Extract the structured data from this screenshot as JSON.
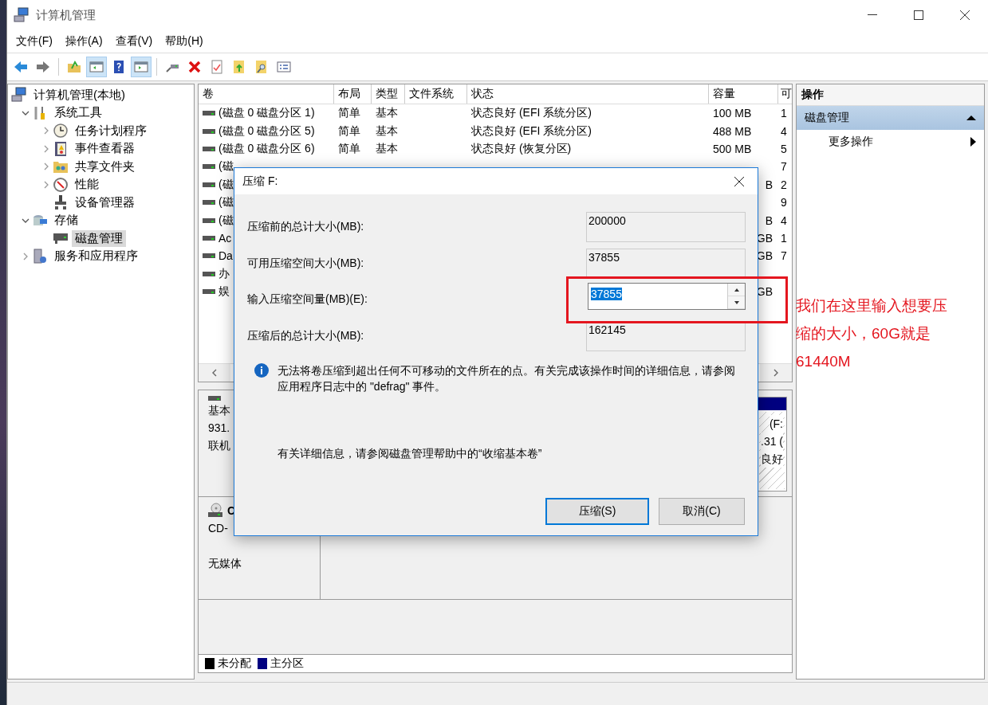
{
  "window": {
    "title": "计算机管理"
  },
  "menu": [
    "文件(F)",
    "操作(A)",
    "查看(V)",
    "帮助(H)"
  ],
  "toolbar": [
    {
      "pressed": false
    },
    {
      "pressed": false
    },
    {
      "pressed": false
    },
    {
      "pressed": true
    },
    {
      "pressed": false
    },
    {
      "pressed": true
    },
    {
      "pressed": false
    },
    {
      "pressed": false
    },
    {
      "pressed": false
    },
    {
      "pressed": false
    },
    {
      "pressed": false
    },
    {
      "pressed": false
    }
  ],
  "tree": [
    {
      "label": "计算机管理(本地)",
      "selected": false,
      "children": [
        {
          "label": "系统工具",
          "selected": false,
          "expanded": true,
          "children": [
            {
              "label": "任务计划程序",
              "selected": false,
              "expanded": false
            },
            {
              "label": "事件查看器",
              "selected": false,
              "expanded": false
            },
            {
              "label": "共享文件夹",
              "selected": false,
              "expanded": false
            },
            {
              "label": "性能",
              "selected": false,
              "expanded": false
            },
            {
              "label": "设备管理器",
              "selected": false
            }
          ]
        },
        {
          "label": "存储",
          "selected": false,
          "expanded": true,
          "children": [
            {
              "label": "磁盘管理",
              "selected": true
            }
          ]
        },
        {
          "label": "服务和应用程序",
          "selected": false,
          "expanded": false
        }
      ]
    }
  ],
  "table": {
    "columns": [
      "卷",
      "布局",
      "类型",
      "文件系统",
      "状态",
      "容量",
      "可"
    ],
    "rows": [
      {
        "kind": "full",
        "volume": "(磁盘 0 磁盘分区 1)",
        "layout": "简单",
        "type": "基本",
        "status": "状态良好 (EFI 系统分区)",
        "capacity": "100 MB",
        "column_7": "1"
      },
      {
        "kind": "full",
        "volume": "(磁盘 0 磁盘分区 5)",
        "layout": "简单",
        "type": "基本",
        "status": "状态良好 (EFI 系统分区)",
        "capacity": "488 MB",
        "column_7": "4"
      },
      {
        "kind": "full",
        "volume": "(磁盘 0 磁盘分区 6)",
        "layout": "简单",
        "type": "基本",
        "status": "状态良好 (恢复分区)",
        "capacity": "500 MB",
        "column_7": "5"
      },
      {
        "kind": "covered",
        "volume": "(磁",
        "column_7": "7"
      },
      {
        "kind": "covered",
        "volume": "(磁",
        "capacity": "B",
        "column_7": "2"
      },
      {
        "kind": "covered",
        "volume": "(磁",
        "column_7": "9"
      },
      {
        "kind": "covered",
        "volume": "(磁",
        "capacity": "B",
        "column_7": "4"
      },
      {
        "kind": "covered",
        "volume": "Ac",
        "capacity": "GB",
        "column_7": "1"
      },
      {
        "kind": "covered",
        "volume": "Da",
        "capacity": "GB",
        "column_7": "7"
      },
      {
        "kind": "covered",
        "volume": "办"
      },
      {
        "kind": "covered",
        "volume": "娱",
        "capacity": "GB"
      }
    ]
  },
  "disks": [
    {
      "kind": "disk",
      "lines": [
        "基本",
        "931.",
        "联机"
      ],
      "partition": {
        "lines": [
          "(F:",
          ".31 (",
          "良好"
        ]
      }
    },
    {
      "kind": "cdrom",
      "name": "C",
      "lines": [
        "CD-",
        "无媒体"
      ]
    }
  ],
  "legend": [
    {
      "label": "未分配",
      "color": "#000000"
    },
    {
      "label": "主分区",
      "color": "#000080"
    }
  ],
  "actions": {
    "title": "操作",
    "items": [
      {
        "kind": "header",
        "label": "磁盘管理"
      },
      {
        "kind": "item",
        "label": "更多操作"
      }
    ]
  },
  "dialog": {
    "title": "压缩 F:",
    "fields": [
      {
        "kind": "readonly",
        "label": "压缩前的总计大小(MB):",
        "value": "200000"
      },
      {
        "kind": "readonly",
        "label": "可用压缩空间大小(MB):",
        "value": "37855"
      },
      {
        "kind": "spin",
        "label": "输入压缩空间量(MB)(E):",
        "value": "37855",
        "text_selected": true
      },
      {
        "kind": "readonly",
        "label": "压缩后的总计大小(MB):",
        "value": "162145"
      }
    ],
    "info": "无法将卷压缩到超出任何不可移动的文件所在的点。有关完成该操作时间的详细信息，请参阅应用程序日志中的 \"defrag\" 事件。",
    "detail": "有关详细信息，请参阅磁盘管理帮助中的“收缩基本卷”",
    "buttons": [
      {
        "label": "压缩(S)",
        "default": true
      },
      {
        "label": "取消(C)",
        "default": false
      }
    ]
  },
  "annotation": {
    "text": "我们在这里输入想要压缩的大小，60G就是61440M"
  }
}
